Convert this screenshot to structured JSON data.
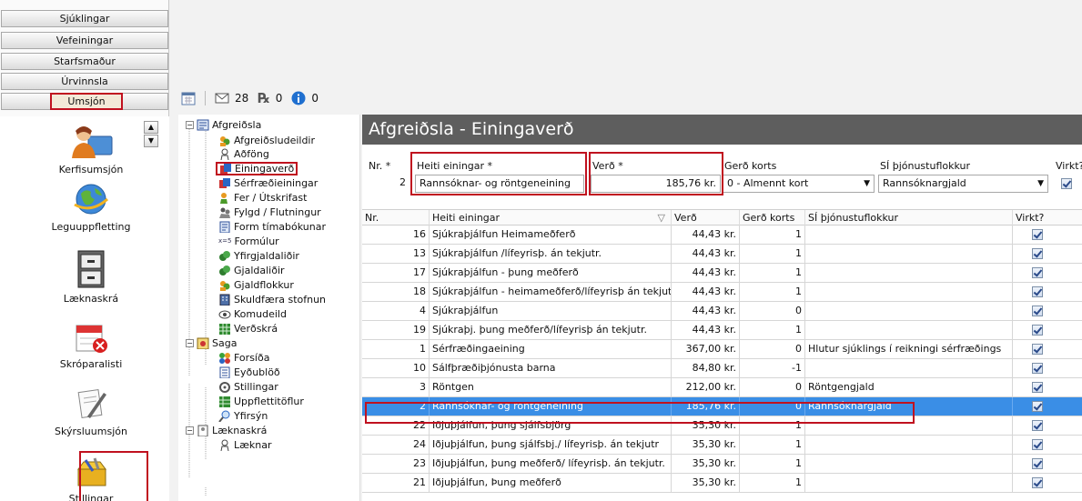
{
  "nav": {
    "buttons": [
      "Sjúklingar",
      "Vefeiningar",
      "Starfsmaður",
      "Úrvinnsla",
      "Umsjón"
    ],
    "modules": [
      "Kerfisumsjón",
      "Leguuppfletting",
      "Læknaskrá",
      "Skróparalisti",
      "Skýrsluumsjón",
      "Stillingar"
    ]
  },
  "toolbar": {
    "mail_count": "28",
    "rx_count": "0",
    "info_count": "0"
  },
  "tree": {
    "root1": "Afgreiðsla",
    "root1_items": [
      "Afgreiðsludeildir",
      "Aðföng",
      "Einingaverð",
      "Sérfræðieiningar",
      "Fer / Útskrifast",
      "Fylgd / Flutningur",
      "Form tímabókunar",
      "Formúlur",
      "Yfirgjaldaliðir",
      "Gjaldaliðir",
      "Gjaldflokkur",
      "Skuldfæra stofnun",
      "Komudeild",
      "Verðskrá"
    ],
    "root2": "Saga",
    "root2_items": [
      "Forsíða",
      "Eyðublöð",
      "Stillingar",
      "Uppflettitöflur",
      "Yfirsýn"
    ],
    "root3": "Læknaskrá",
    "root3_items": [
      "Læknar"
    ]
  },
  "panel": {
    "title": "Afgreiðsla - Einingaverð",
    "form": {
      "nr_label": "Nr. *",
      "nr_value": "2",
      "heiti_label": "Heiti einingar *",
      "heiti_value": "Rannsóknar- og röntgeneining",
      "verd_label": "Verð *",
      "verd_value": "185,76 kr.",
      "gerd_label": "Gerð korts",
      "gerd_value": "0 - Almennt kort",
      "si_label": "SÍ þjónustuflokkur",
      "si_value": "Rannsóknargjald",
      "virkt_label": "Virkt?"
    },
    "grid_headers": [
      "Nr.",
      "Heiti einingar",
      "Verð",
      "Gerð korts",
      "SÍ þjónustuflokkur",
      "Virkt?"
    ],
    "rows": [
      {
        "nr": "16",
        "heiti": "Sjúkraþjálfun Heimameðferð",
        "verd": "44,43 kr.",
        "gerd": "1",
        "si": ""
      },
      {
        "nr": "13",
        "heiti": "Sjúkraþjálfun /lífeyrisþ. án tekjutr.",
        "verd": "44,43 kr.",
        "gerd": "1",
        "si": ""
      },
      {
        "nr": "17",
        "heiti": "Sjúkraþjálfun - þung meðferð",
        "verd": "44,43 kr.",
        "gerd": "1",
        "si": ""
      },
      {
        "nr": "18",
        "heiti": "Sjúkraþjálfun - heimameðferð/lífeyrisþ án tekjut",
        "verd": "44,43 kr.",
        "gerd": "1",
        "si": ""
      },
      {
        "nr": "4",
        "heiti": "Sjúkraþjálfun",
        "verd": "44,43 kr.",
        "gerd": "0",
        "si": ""
      },
      {
        "nr": "19",
        "heiti": "Sjúkraþj. þung meðferð/lífeyrisþ án tekjutr.",
        "verd": "44,43 kr.",
        "gerd": "1",
        "si": ""
      },
      {
        "nr": "1",
        "heiti": "Sérfræðingaeining",
        "verd": "367,00 kr.",
        "gerd": "0",
        "si": "Hlutur sjúklings í reikningi sérfræðings"
      },
      {
        "nr": "10",
        "heiti": "Sálfþræðiþjónusta barna",
        "verd": "84,80 kr.",
        "gerd": "-1",
        "si": ""
      },
      {
        "nr": "3",
        "heiti": "Röntgen",
        "verd": "212,00 kr.",
        "gerd": "0",
        "si": "Röntgengjald"
      },
      {
        "nr": "2",
        "heiti": "Rannsóknar- og röntgeneining",
        "verd": "185,76 kr.",
        "gerd": "0",
        "si": "Rannsóknargjald"
      },
      {
        "nr": "22",
        "heiti": "Iðjuþjálfun, þung sjálfsbjörg",
        "verd": "35,30 kr.",
        "gerd": "1",
        "si": ""
      },
      {
        "nr": "24",
        "heiti": "Iðjuþjálfun, þung sjálfsbj./ lífeyrisþ. án tekjutr",
        "verd": "35,30 kr.",
        "gerd": "1",
        "si": ""
      },
      {
        "nr": "23",
        "heiti": "Iðjuþjálfun, þung meðferð/ lífeyrisþ. án tekjutr.",
        "verd": "35,30 kr.",
        "gerd": "1",
        "si": ""
      },
      {
        "nr": "21",
        "heiti": "Iðjuþjálfun, Þung meðferð",
        "verd": "35,30 kr.",
        "gerd": "1",
        "si": ""
      }
    ],
    "selected_row_index": 9
  },
  "colors": {
    "accent_red": "#c0111f",
    "header_bg": "#5e5e5e",
    "selection": "#3a8ee6"
  }
}
